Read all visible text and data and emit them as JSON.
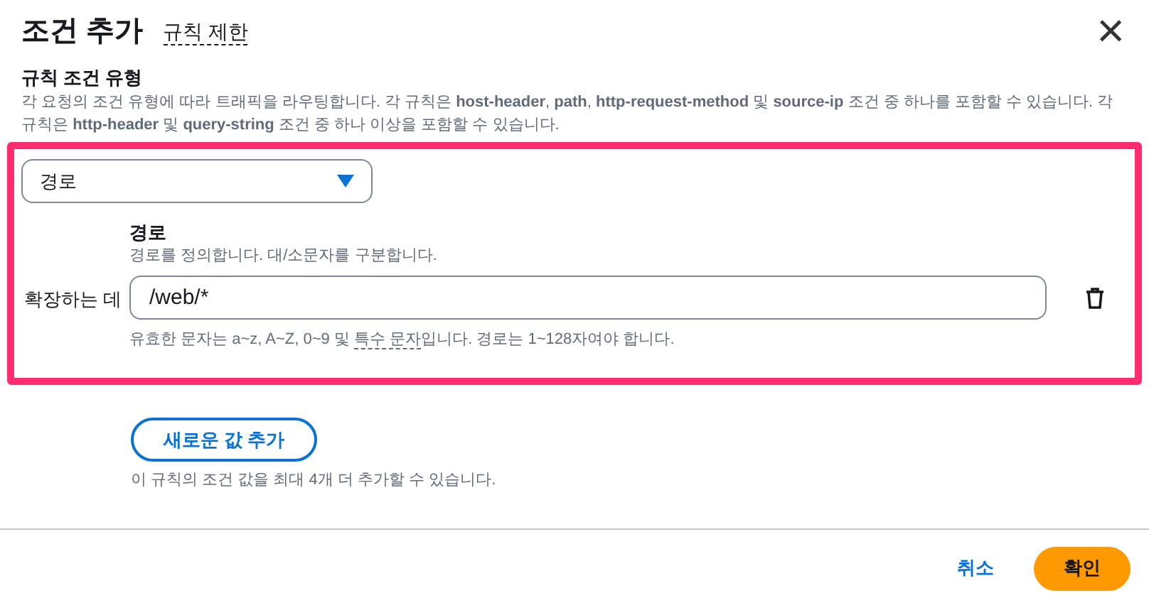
{
  "dialog": {
    "title": "조건 추가",
    "subtitle": "규칙 제한",
    "close": "×"
  },
  "condition_type": {
    "label": "규칙 조건 유형",
    "description": "각 요청의 조건 유형에 따라 트래픽을 라우팅합니다. 각 규칙은 **host-header**, **path**, **http-request-method** 및 **source-ip** 조건 중 하나를 포함할 수 있습니다. 각 규칙은 **http-header** 및 **query-string** 조건 중 하나 이상을 포함할 수 있습니다.",
    "select_value": "경로"
  },
  "path": {
    "label": "경로",
    "description": "경로를 정의합니다. 대/소문자를 구분합니다.",
    "row_label": "확장하는 데",
    "value": "/web/*",
    "help_before": "유효한 문자는 a~z, A~Z, 0~9 및 ",
    "help_link": "특수 문자",
    "help_after": "입니다. 경로는 1~128자여야 합니다."
  },
  "add_value": {
    "button": "새로운 값 추가",
    "note": "이 규칙의 조건 값을 최대 4개 더 추가할 수 있습니다."
  },
  "footer": {
    "cancel": "취소",
    "confirm": "확인"
  }
}
